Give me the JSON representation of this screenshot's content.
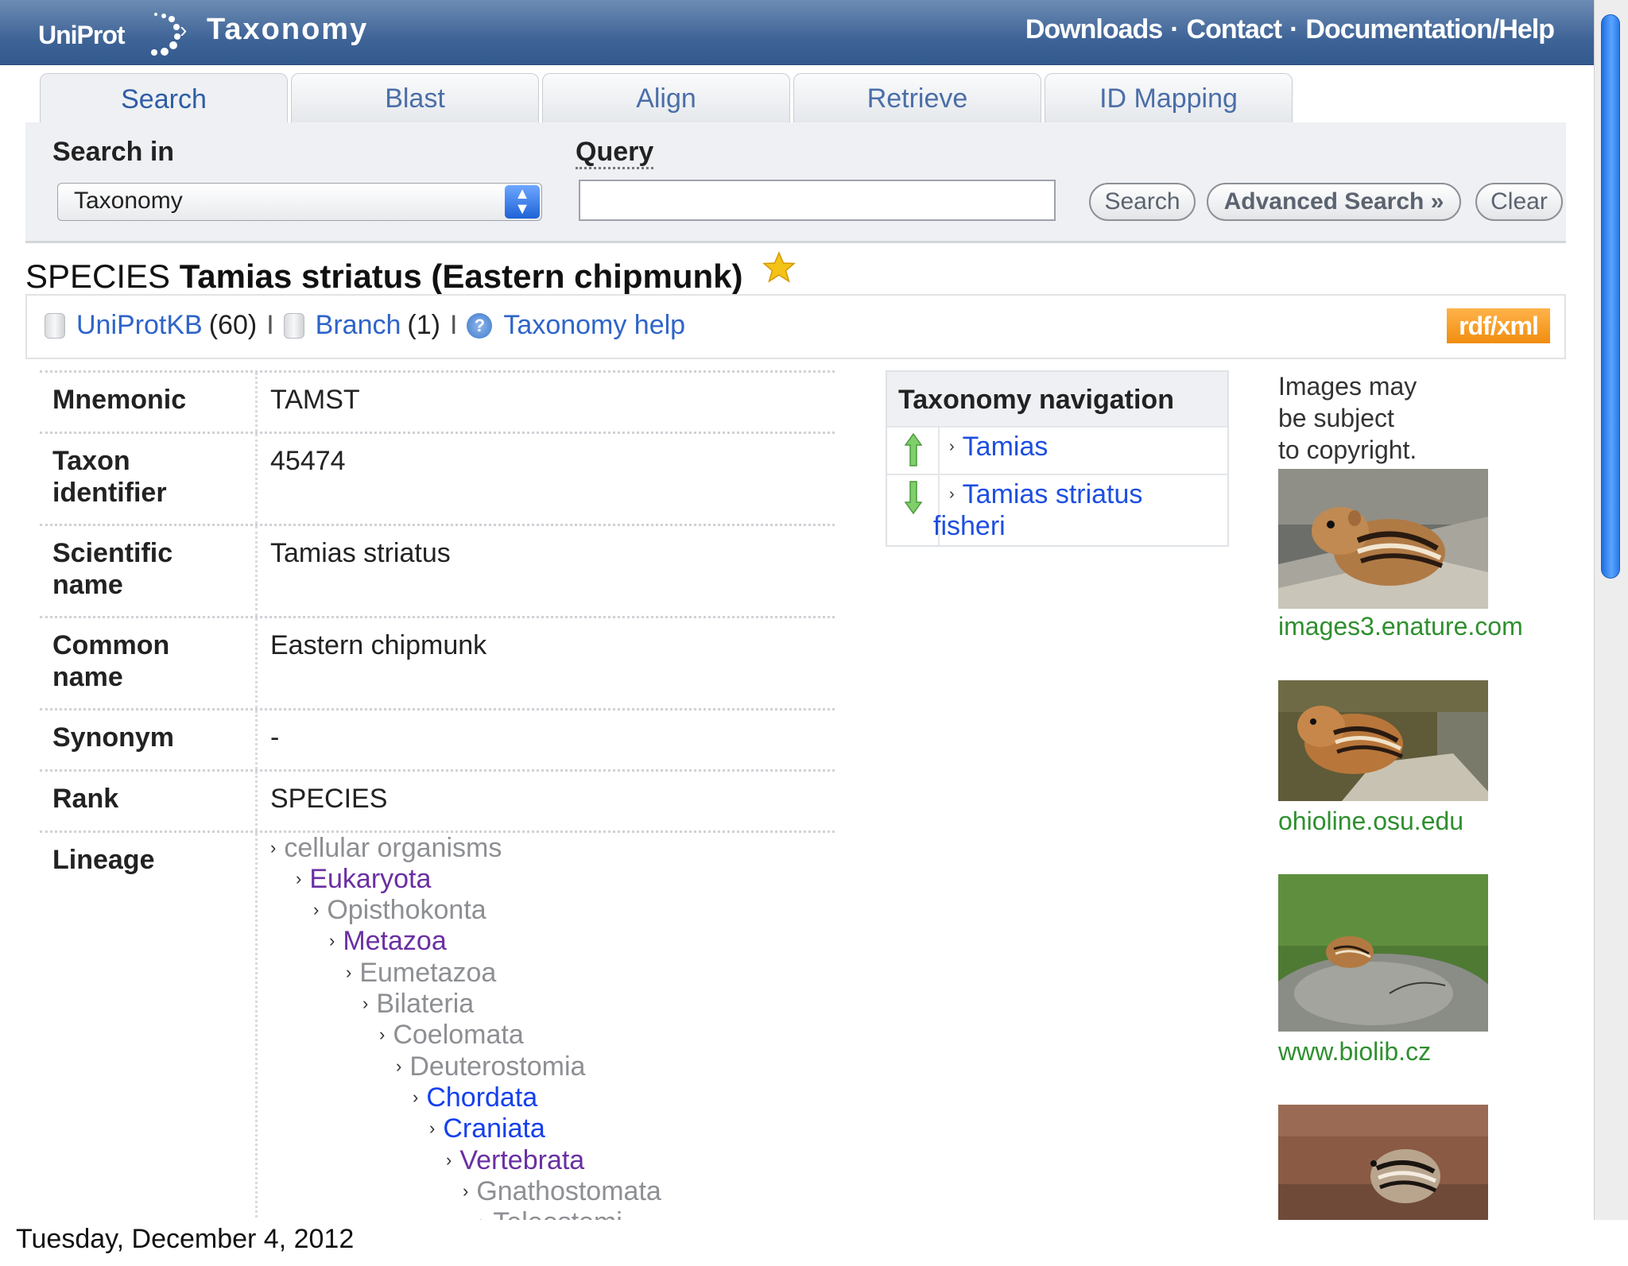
{
  "header": {
    "logo_text": "UniProt",
    "breadcrumb_sep": "›",
    "section_title": "Taxonomy",
    "links": [
      "Downloads",
      "Contact",
      "Documentation/Help"
    ],
    "link_separator": "·"
  },
  "tabs": [
    {
      "label": "Search",
      "active": true
    },
    {
      "label": "Blast"
    },
    {
      "label": "Align"
    },
    {
      "label": "Retrieve"
    },
    {
      "label": "ID Mapping"
    }
  ],
  "search": {
    "search_in_label": "Search in",
    "query_label": "Query",
    "search_in_value": "Taxonomy",
    "query_value": "",
    "search_button": "Search",
    "advanced_button": "Advanced Search »",
    "clear_button": "Clear"
  },
  "entry": {
    "rank_word": "SPECIES",
    "name": "Tamias striatus (Eastern chipmunk)"
  },
  "toolbar": {
    "uniprotkb_label": "UniProtKB",
    "uniprotkb_count": "(60)",
    "branch_label": "Branch",
    "branch_count": "(1)",
    "separator": "I",
    "help_label": "Taxonomy help",
    "rdf_label": "rdf/xml"
  },
  "fields": {
    "mnemonic": {
      "label": "Mnemonic",
      "value": "TAMST"
    },
    "taxon_id": {
      "label_1": "Taxon",
      "label_2": "identifier",
      "value": "45474"
    },
    "scientific_name": {
      "label_1": "Scientific",
      "label_2": "name",
      "value": "Tamias striatus"
    },
    "common_name": {
      "label_1": "Common",
      "label_2": "name",
      "value": "Eastern chipmunk"
    },
    "synonym": {
      "label": "Synonym",
      "value": "-"
    },
    "rank": {
      "label": "Rank",
      "value": "SPECIES"
    },
    "lineage": {
      "label": "Lineage"
    }
  },
  "lineage": [
    {
      "name": "cellular organisms",
      "style": "gray"
    },
    {
      "name": "Eukaryota",
      "style": "purple"
    },
    {
      "name": "Opisthokonta",
      "style": "gray"
    },
    {
      "name": "Metazoa",
      "style": "purple"
    },
    {
      "name": "Eumetazoa",
      "style": "gray"
    },
    {
      "name": "Bilateria",
      "style": "gray"
    },
    {
      "name": "Coelomata",
      "style": "gray"
    },
    {
      "name": "Deuterostomia",
      "style": "gray"
    },
    {
      "name": "Chordata",
      "style": "blue"
    },
    {
      "name": "Craniata",
      "style": "blue"
    },
    {
      "name": "Vertebrata",
      "style": "purple"
    },
    {
      "name": "Gnathostomata",
      "style": "gray"
    },
    {
      "name": "Teleostomi",
      "style": "gray"
    }
  ],
  "navigation": {
    "title": "Taxonomy navigation",
    "parent": "Tamias",
    "child_line_1": "Tamias striatus",
    "child_line_2": "fisheri"
  },
  "images": {
    "note_1": "Images may",
    "note_2": "be subject",
    "note_3": "to copyright.",
    "captions": [
      "images3.enature.com",
      "ohioline.osu.edu",
      "www.biolib.cz"
    ]
  },
  "footer": {
    "date": "Tuesday, December 4, 2012"
  },
  "colors": {
    "header_blue": "#3f6497",
    "link_blue": "#2e64c9",
    "lineage_purple": "#6a2fa3",
    "caption_green": "#2f8f2f",
    "rdf_orange": "#f08d10"
  }
}
